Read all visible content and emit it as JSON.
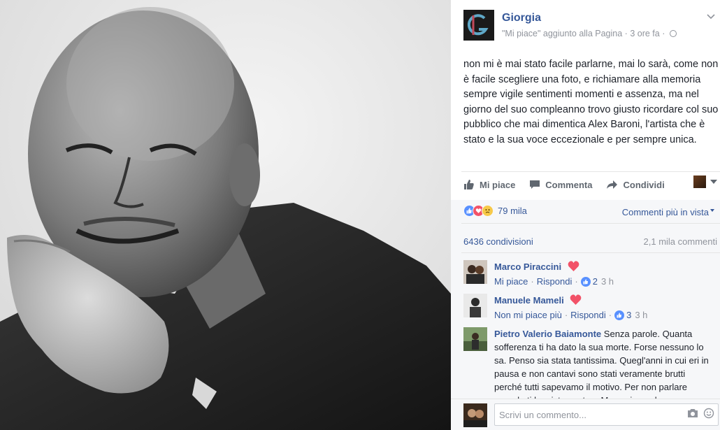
{
  "post": {
    "page_name": "Giorgia",
    "meta_action": "\"Mi piace\" aggiunto alla Pagina",
    "meta_time": "3 ore fa",
    "text": "non mi è mai stato facile parlarne, mai lo sarà, come non è facile scegliere una foto, e richiamare alla memoria sempre vigile sentimenti momenti e assenza, ma nel giorno del suo compleanno trovo giusto ricordare col suo pubblico che mai dimentica Alex Baroni, l'artista che è stato e la sua voce eccezionale e per sempre unica."
  },
  "actions": {
    "like": "Mi piace",
    "comment": "Commenta",
    "share": "Condividi"
  },
  "stats": {
    "reactions_count": "79 mila",
    "sort_label": "Commenti più in vista",
    "shares": "6436 condivisioni",
    "comments_total": "2,1 mila commenti"
  },
  "comments": [
    {
      "author": "Marco Piraccini",
      "text": "",
      "action_label": "Mi piace",
      "reply_label": "Rispondi",
      "likes": "2",
      "time": "3 h"
    },
    {
      "author": "Manuele Mameli",
      "text": "",
      "action_label": "Non mi piace più",
      "reply_label": "Rispondi",
      "likes": "3",
      "time": "3 h"
    },
    {
      "author": "Pietro Valerio Baiamonte",
      "text": "Senza parole. Quanta sofferenza ti ha dato la sua morte. Forse nessuno lo sa. Penso sia stata tantissima. Quegl'anni in cui eri in pausa e non cantavi sono stati veramente brutti perché tutti sapevamo il motivo. Per non parlare quando ti ho vista cantare Messo in quel"
    }
  ],
  "composer": {
    "placeholder": "Scrivi un commento..."
  },
  "icons": {
    "like": "thumbs-up-icon",
    "comment": "speech-bubble-icon",
    "share": "share-arrow-icon",
    "camera": "camera-icon",
    "emoji": "emoji-icon",
    "privacy": "globe-icon",
    "menu": "chevron-down-icon"
  },
  "colors": {
    "link": "#365899",
    "muted": "#90949c",
    "like_blue": "#5890ff",
    "love_red": "#f25268"
  }
}
